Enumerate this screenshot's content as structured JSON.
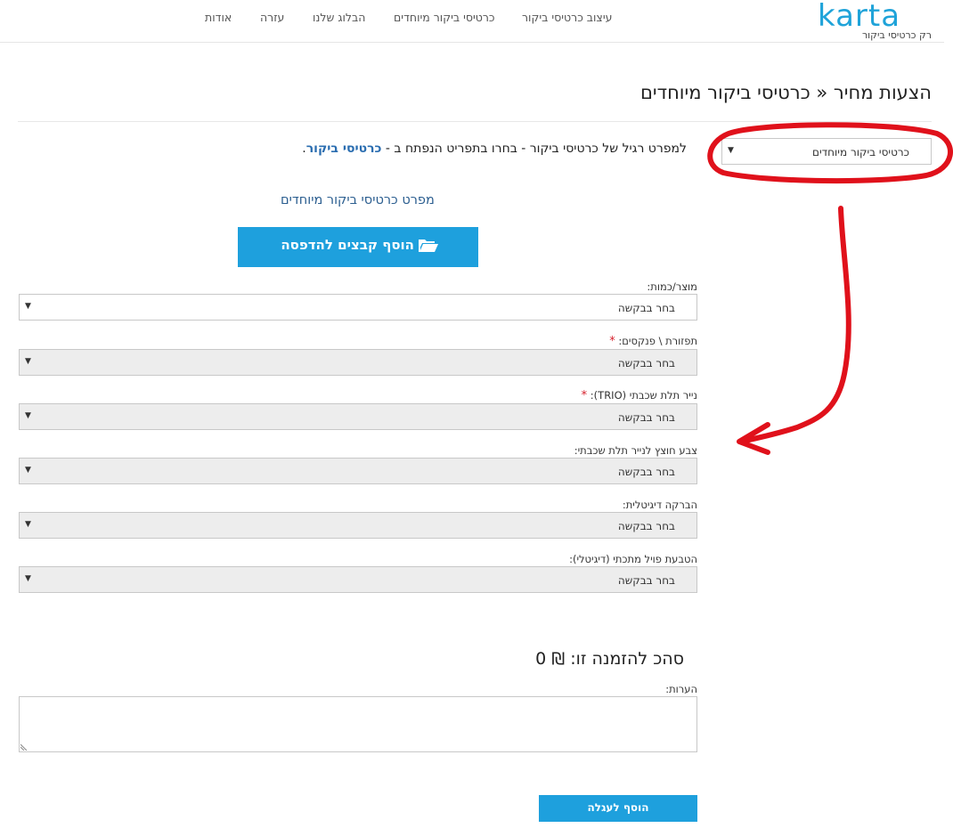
{
  "header": {
    "logo_text": "karta",
    "logo_tagline": "רק כרטיסי ביקור",
    "nav": [
      "עיצוב כרטיסי ביקור",
      "כרטיסי ביקור מיוחדים",
      "הבלוג שלנו",
      "עזרה",
      "אודות"
    ]
  },
  "page": {
    "title": "הצעות מחיר « כרטיסי ביקור מיוחדים"
  },
  "category_select": {
    "value": "כרטיסי ביקור מיוחדים"
  },
  "info": {
    "text": "למפרט רגיל של כרטיסי ביקור - בחרו בתפריט הנפתח ב - ",
    "link": "כרטיסי ביקור",
    "end": "."
  },
  "spec_link": "מפרט כרטיסי ביקור מיוחדים",
  "upload_button": "הוסף קבצים להדפסה",
  "form": {
    "fields": [
      {
        "label": "מוצר/כמות:",
        "required": false,
        "value": "בחר בבקשה"
      },
      {
        "label": "תפזורת \\ פנקסים:",
        "required": true,
        "value": "בחר בבקשה"
      },
      {
        "label": "נייר תלת שכבתי (TRIO):",
        "required": true,
        "value": "בחר בבקשה"
      },
      {
        "label": "צבע חוצץ לנייר תלת שכבתי:",
        "required": false,
        "value": "בחר בבקשה"
      },
      {
        "label": "הברקה דיגיטלית:",
        "required": false,
        "value": "בחר בבקשה"
      },
      {
        "label": "הטבעת פויל מתכתי (דיגיטלי):",
        "required": false,
        "value": "בחר בבקשה"
      }
    ],
    "required_mark": "*"
  },
  "total": {
    "label": "סהכ להזמנה זו:",
    "currency": "₪",
    "amount": "0"
  },
  "notes": {
    "label": "הערות:",
    "value": ""
  },
  "cart_button": "הוסף לעגלה",
  "colors": {
    "accent": "#1ea0dd",
    "annotation": "#e0111b",
    "required": "#d6202c"
  }
}
